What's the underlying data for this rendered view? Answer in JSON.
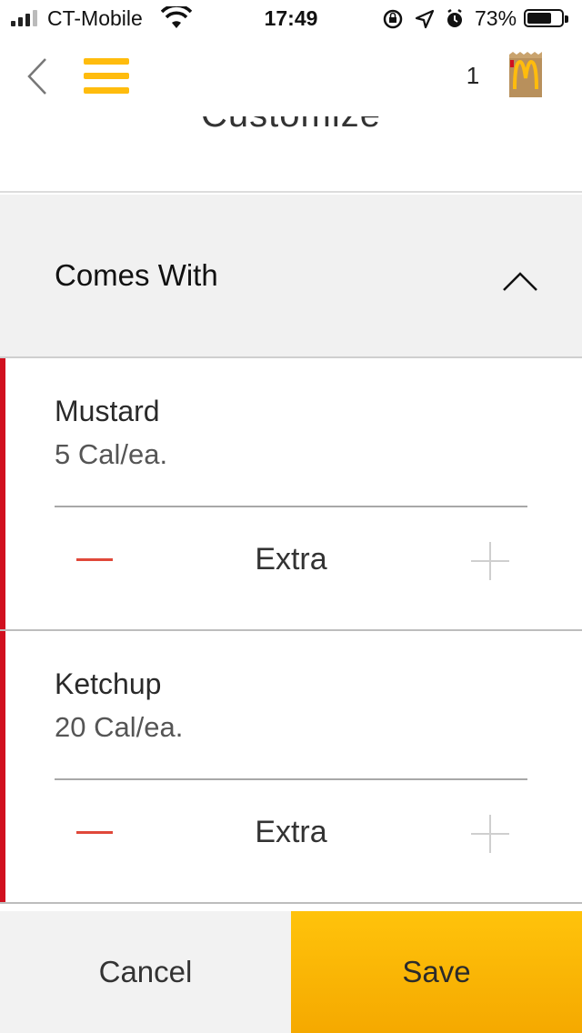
{
  "status_bar": {
    "carrier": "CT-Mobile",
    "time": "17:49",
    "battery_percent": "73%",
    "battery_level": 0.73
  },
  "nav": {
    "bag_count": "1",
    "icons": [
      "back-chevron-icon",
      "hamburger-menu-icon",
      "mcdonalds-bag-icon"
    ]
  },
  "page": {
    "title": "Customize"
  },
  "section": {
    "title": "Comes With",
    "expanded": true
  },
  "items": [
    {
      "name": "Mustard",
      "calories": "5  Cal/ea.",
      "level": "Extra"
    },
    {
      "name": "Ketchup",
      "calories": "20  Cal/ea.",
      "level": "Extra"
    }
  ],
  "footer": {
    "cancel_label": "Cancel",
    "save_label": "Save"
  },
  "colors": {
    "accent_yellow": "#ffbc0d",
    "accent_red": "#d1101f",
    "minus_red": "#e0483a"
  }
}
